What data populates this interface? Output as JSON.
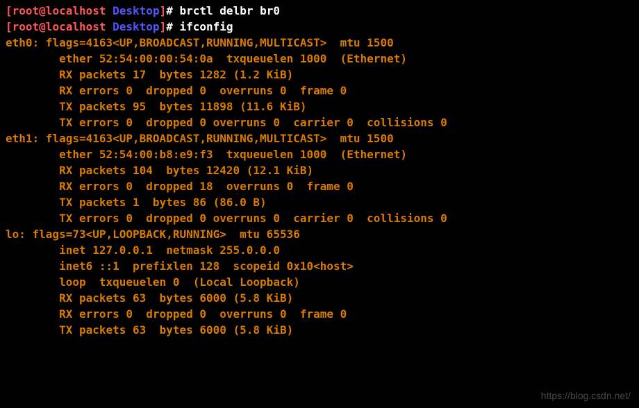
{
  "prompt": {
    "user_host": "root@localhost",
    "path": "Desktop",
    "symbol": "#"
  },
  "commands": {
    "cmd1": "brctl delbr br0",
    "cmd2": "ifconfig"
  },
  "output": {
    "eth0_header": "eth0: flags=4163<UP,BROADCAST,RUNNING,MULTICAST>  mtu 1500",
    "eth0_ether": "        ether 52:54:00:00:54:0a  txqueuelen 1000  (Ethernet)",
    "eth0_rxp": "        RX packets 17  bytes 1282 (1.2 KiB)",
    "eth0_rxe": "        RX errors 0  dropped 0  overruns 0  frame 0",
    "eth0_txp": "        TX packets 95  bytes 11898 (11.6 KiB)",
    "eth0_txe": "        TX errors 0  dropped 0 overruns 0  carrier 0  collisions 0",
    "blank1": "",
    "eth1_header": "eth1: flags=4163<UP,BROADCAST,RUNNING,MULTICAST>  mtu 1500",
    "eth1_ether": "        ether 52:54:00:b8:e9:f3  txqueuelen 1000  (Ethernet)",
    "eth1_rxp": "        RX packets 104  bytes 12420 (12.1 KiB)",
    "eth1_rxe": "        RX errors 0  dropped 18  overruns 0  frame 0",
    "eth1_txp": "        TX packets 1  bytes 86 (86.0 B)",
    "eth1_txe": "        TX errors 0  dropped 0 overruns 0  carrier 0  collisions 0",
    "blank2": "",
    "lo_header": "lo: flags=73<UP,LOOPBACK,RUNNING>  mtu 65536",
    "lo_inet": "        inet 127.0.0.1  netmask 255.0.0.0",
    "lo_inet6": "        inet6 ::1  prefixlen 128  scopeid 0x10<host>",
    "lo_loop": "        loop  txqueuelen 0  (Local Loopback)",
    "lo_rxp": "        RX packets 63  bytes 6000 (5.8 KiB)",
    "lo_rxe": "        RX errors 0  dropped 0  overruns 0  frame 0",
    "lo_txp": "        TX packets 63  bytes 6000 (5.8 KiB)"
  },
  "watermark": "https://blog.csdn.net/"
}
